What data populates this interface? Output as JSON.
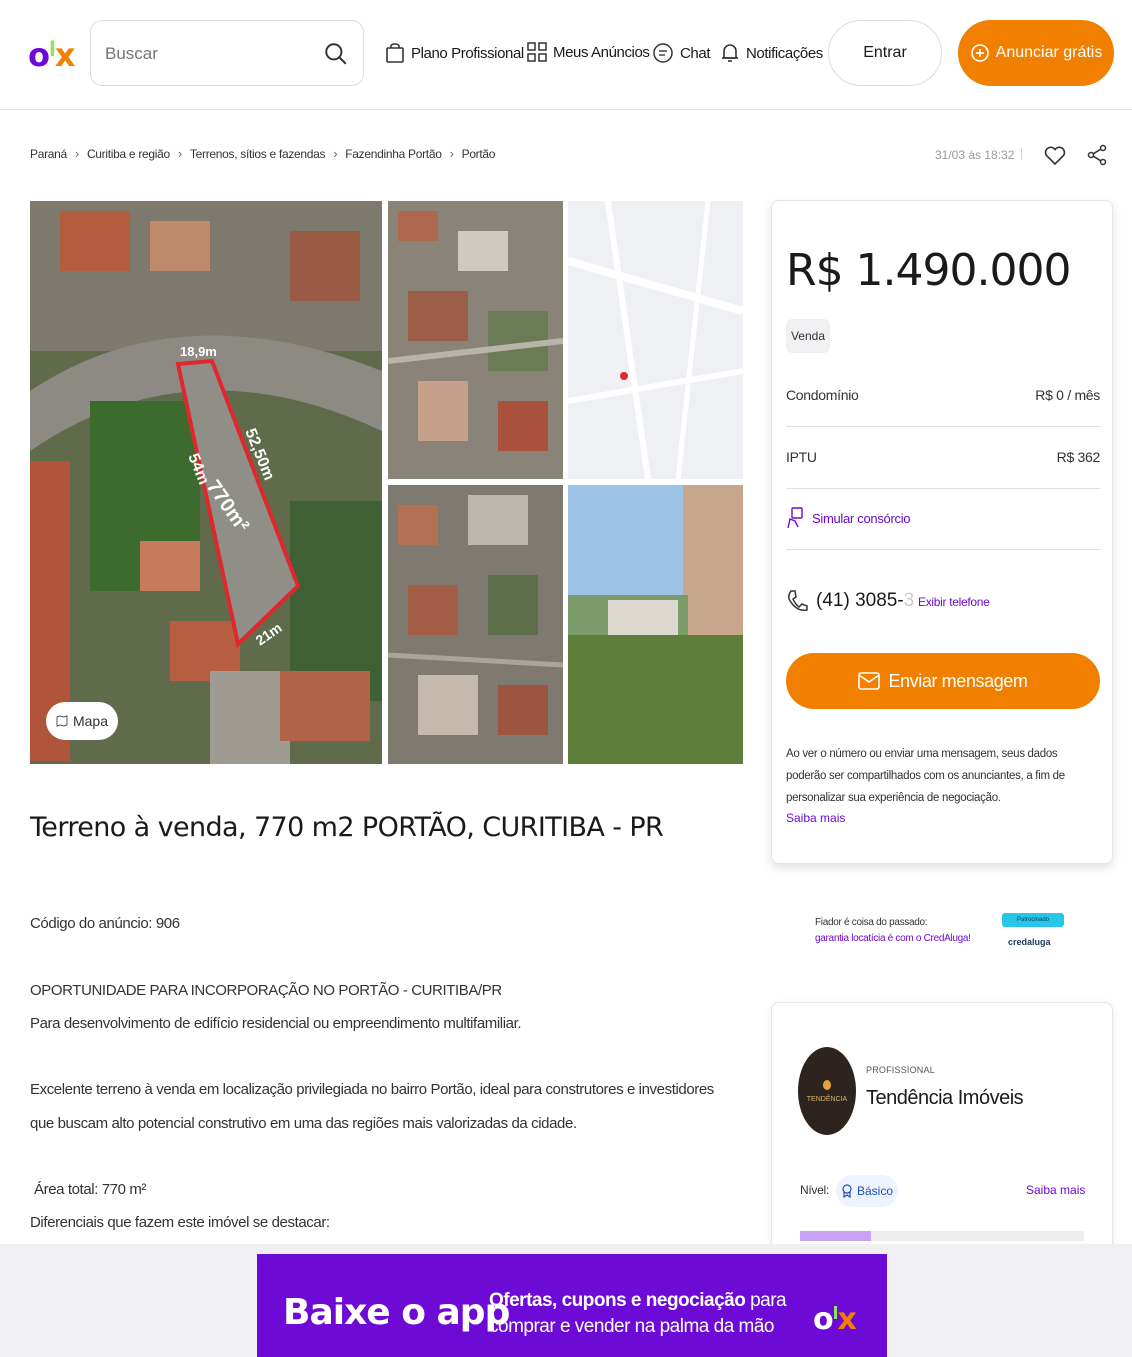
{
  "header": {
    "logo": {
      "o": "o",
      "l": "l",
      "x": "x"
    },
    "search": {
      "placeholder": "Buscar"
    },
    "nav": {
      "plano": "Plano Profissional",
      "anuncios": "Meus Anúncios",
      "chat": "Chat",
      "notificacoes": "Notificações"
    },
    "entrar": "Entrar",
    "anunciar": "Anunciar grátis"
  },
  "breadcrumb": [
    "Paraná",
    "Curitiba e região",
    "Terrenos, sítios e fazendas",
    "Fazendinha Portão",
    "Portão"
  ],
  "posted": "31/03 às 18:32",
  "gallery": {
    "mapa": "Mapa",
    "overlay": {
      "m1": "18,9m",
      "m2": "52,50m",
      "m3": "54m",
      "m4": "770m²",
      "m5": "21m"
    }
  },
  "listing": {
    "title": "Terreno à venda, 770 m2 PORTÃO, CURITIBA - PR",
    "code": "Código do anúncio: 906",
    "p1": "OPORTUNIDADE PARA INCORPORAÇÃO NO PORTÃO  - CURITIBA/PR",
    "p2": "Para desenvolvimento de edifício residencial ou empreendimento multifamiliar.",
    "p3": "Excelente terreno à venda em localização privilegiada no bairro Portão, ideal para construtores e investidores",
    "p4": "que buscam alto potencial construtivo em uma das regiões mais valorizadas da cidade.",
    "p5": "Área total: 770 m²",
    "p6": "Diferenciais que fazem este imóvel se destacar:"
  },
  "price_card": {
    "price": "R$ 1.490.000",
    "type": "Venda",
    "condominio_label": "Condomínio",
    "condominio_value": "R$ 0 / mês",
    "iptu_label": "IPTU",
    "iptu_value": "R$ 362",
    "simular": "Simular consórcio",
    "phone_visible": "(41) 3085-",
    "phone_faded": "3",
    "exibir": "Exibir telefone",
    "enviar": "Enviar mensagem",
    "disclaimer": "Ao ver o número ou enviar uma mensagem, seus dados poderão ser compartilhados com os anunciantes, a fim de personalizar sua experiência de negociação.",
    "saiba": "Saiba mais"
  },
  "credit_ad": {
    "line1": "Fiador é coisa do passado:",
    "line2": "garantia locatícia é com o CredAluga!",
    "tag": "Patrocinado",
    "brand": "credaluga"
  },
  "seller": {
    "avatar_text": "TENDÊNCIA",
    "label": "PROFISSIONAL",
    "name": "Tendência Imóveis",
    "nivel_label": "Nível:",
    "nivel_value": "Básico",
    "saiba": "Saiba mais",
    "level_progress": 0.25
  },
  "banner": {
    "title": "Baixe o app",
    "line1_bold": "Ofertas, cupons e negociação",
    "line1_rest": " para",
    "line2": "comprar e vender na palma da mão"
  },
  "colors": {
    "accent": "#f28000",
    "brand": "#6e0ad6",
    "logo_green": "#8ce563"
  }
}
